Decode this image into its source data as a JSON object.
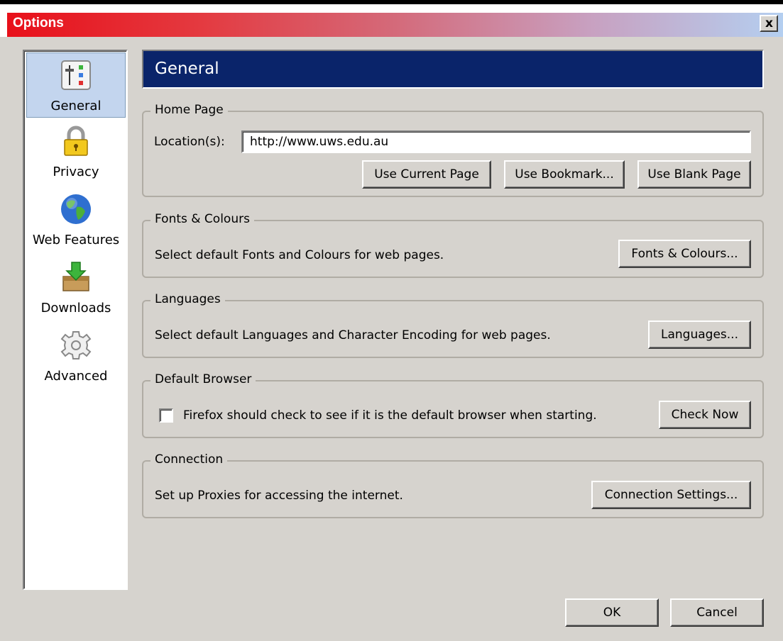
{
  "window": {
    "title": "Options",
    "close_label": "x"
  },
  "sidebar": {
    "items": [
      {
        "label": "General",
        "icon": "general-settings-icon",
        "selected": true
      },
      {
        "label": "Privacy",
        "icon": "padlock-icon",
        "selected": false
      },
      {
        "label": "Web Features",
        "icon": "globe-icon",
        "selected": false
      },
      {
        "label": "Downloads",
        "icon": "download-box-icon",
        "selected": false
      },
      {
        "label": "Advanced",
        "icon": "gear-icon",
        "selected": false
      }
    ]
  },
  "panel": {
    "heading": "General"
  },
  "home_page": {
    "title": "Home Page",
    "location_label": "Location(s):",
    "location_value": "http://www.uws.edu.au",
    "use_current_label": "Use Current Page",
    "use_bookmark_label": "Use Bookmark...",
    "use_blank_label": "Use Blank Page"
  },
  "fonts_colours": {
    "title": "Fonts & Colours",
    "description": "Select default Fonts and Colours for web pages.",
    "button_label": "Fonts & Colours..."
  },
  "languages": {
    "title": "Languages",
    "description": "Select default Languages and Character Encoding for web pages.",
    "button_label": "Languages..."
  },
  "default_browser": {
    "title": "Default Browser",
    "checkbox_label": "Firefox should check to see if it is the default browser when starting.",
    "checked": false,
    "button_label": "Check Now"
  },
  "connection": {
    "title": "Connection",
    "description": "Set up Proxies for accessing the internet.",
    "button_label": "Connection Settings..."
  },
  "footer": {
    "ok_label": "OK",
    "cancel_label": "Cancel"
  },
  "colors": {
    "heading_bg": "#0a246a",
    "selected_item_bg": "#c3d5ee",
    "dialog_bg": "#d6d3ce"
  }
}
